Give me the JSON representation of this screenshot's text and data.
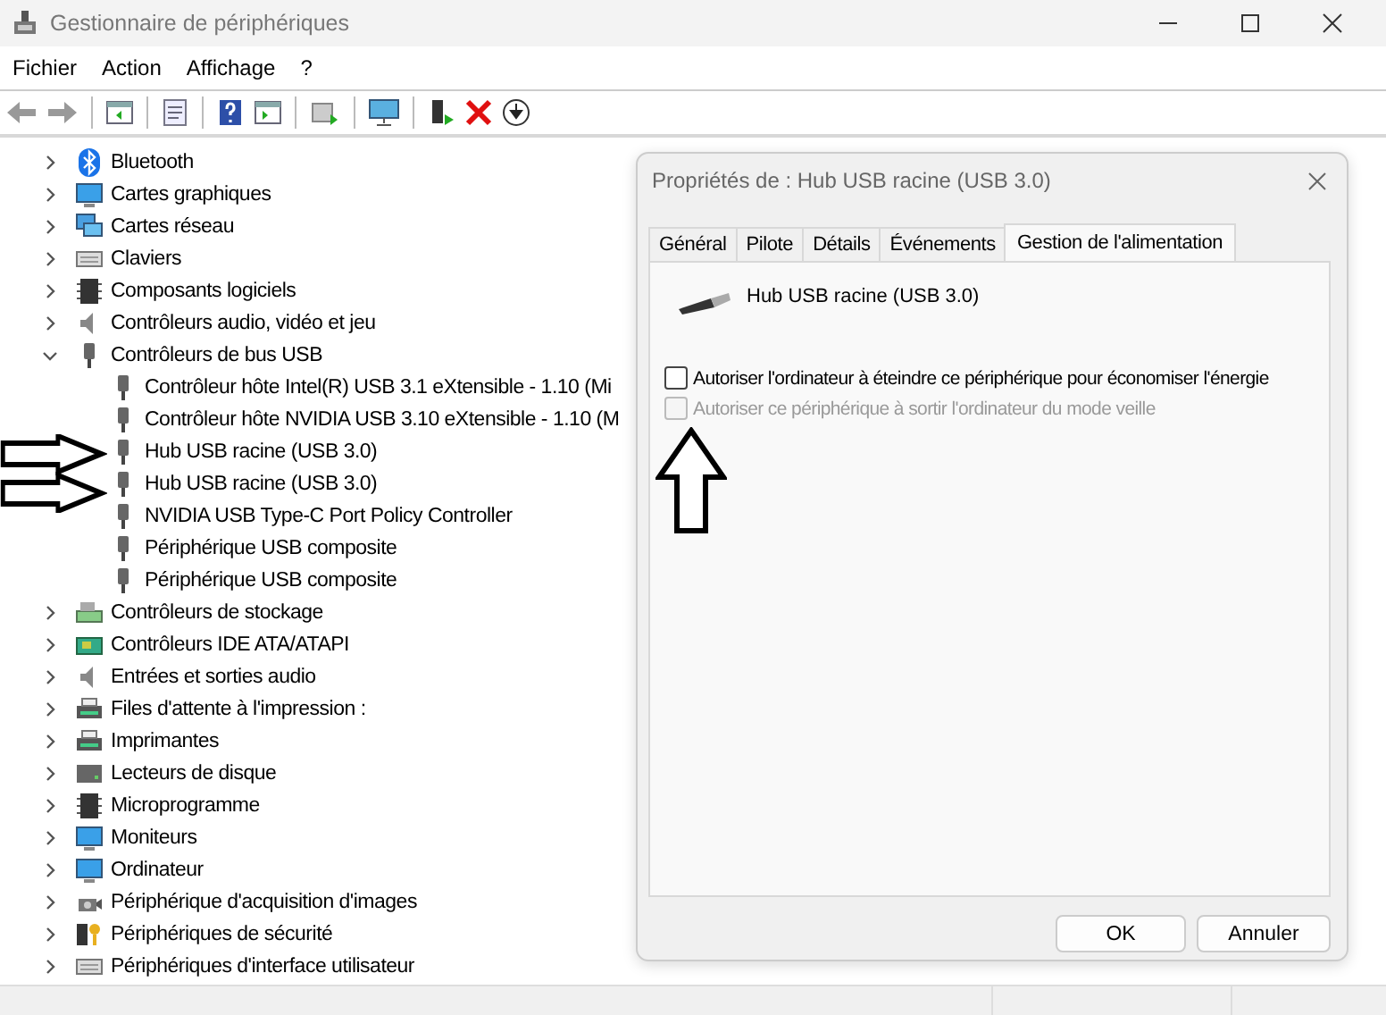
{
  "window": {
    "title": "Gestionnaire de périphériques"
  },
  "menu": [
    "Fichier",
    "Action",
    "Affichage",
    "?"
  ],
  "tree": [
    {
      "label": "Bluetooth",
      "expanded": false
    },
    {
      "label": "Cartes graphiques",
      "expanded": false
    },
    {
      "label": "Cartes réseau",
      "expanded": false
    },
    {
      "label": "Claviers",
      "expanded": false
    },
    {
      "label": "Composants logiciels",
      "expanded": false
    },
    {
      "label": "Contrôleurs audio, vidéo et jeu",
      "expanded": false
    },
    {
      "label": "Contrôleurs de bus USB",
      "expanded": true,
      "children": [
        {
          "label": "Contrôleur hôte Intel(R) USB 3.1 eXtensible - 1.10 (Mi"
        },
        {
          "label": "Contrôleur hôte NVIDIA USB 3.10 eXtensible - 1.10 (M"
        },
        {
          "label": "Hub USB racine (USB 3.0)"
        },
        {
          "label": "Hub USB racine (USB 3.0)"
        },
        {
          "label": "NVIDIA USB Type-C Port Policy Controller"
        },
        {
          "label": "Périphérique USB composite"
        },
        {
          "label": "Périphérique USB composite"
        }
      ]
    },
    {
      "label": "Contrôleurs de stockage",
      "expanded": false
    },
    {
      "label": "Contrôleurs IDE ATA/ATAPI",
      "expanded": false
    },
    {
      "label": "Entrées et sorties audio",
      "expanded": false
    },
    {
      "label": "Files d'attente à l'impression :",
      "expanded": false
    },
    {
      "label": "Imprimantes",
      "expanded": false
    },
    {
      "label": "Lecteurs de disque",
      "expanded": false
    },
    {
      "label": "Microprogramme",
      "expanded": false
    },
    {
      "label": "Moniteurs",
      "expanded": false
    },
    {
      "label": "Ordinateur",
      "expanded": false
    },
    {
      "label": "Périphérique d'acquisition d'images",
      "expanded": false
    },
    {
      "label": "Périphériques de sécurité",
      "expanded": false
    },
    {
      "label": "Périphériques d'interface utilisateur",
      "expanded": false
    }
  ],
  "dialog": {
    "title": "Propriétés de : Hub USB racine (USB 3.0)",
    "tabs": [
      {
        "label": "Général",
        "selected": false
      },
      {
        "label": "Pilote",
        "selected": false
      },
      {
        "label": "Détails",
        "selected": false
      },
      {
        "label": "Événements",
        "selected": false
      },
      {
        "label": "Gestion de l'alimentation",
        "selected": true
      }
    ],
    "device_name": "Hub USB racine (USB 3.0)",
    "options": [
      {
        "label": "Autoriser l'ordinateur à éteindre ce périphérique pour économiser l'énergie",
        "checked": false,
        "disabled": false
      },
      {
        "label": "Autoriser ce périphérique à sortir l'ordinateur du mode veille",
        "checked": false,
        "disabled": true
      }
    ],
    "buttons": [
      "OK",
      "Annuler"
    ]
  }
}
